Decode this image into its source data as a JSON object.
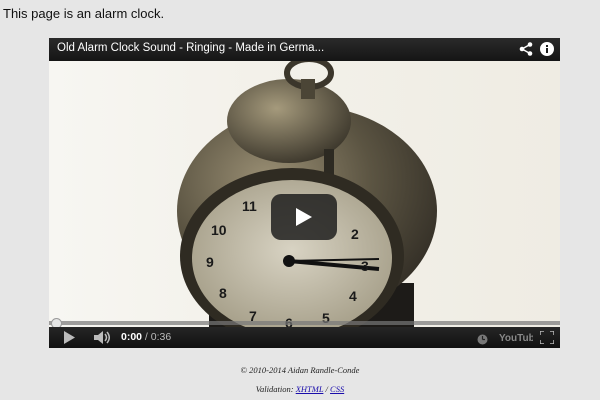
{
  "page": {
    "intro_text": "This page is an alarm clock."
  },
  "player": {
    "title": "Old Alarm Clock Sound - Ringing - Made in Germa...",
    "current_time": "0:00",
    "separator": " / ",
    "duration": "0:36",
    "progress_fraction": 0.0,
    "brand": "YouTube",
    "icons": {
      "share": "share-icon",
      "info": "info-icon",
      "play_overlay": "play-icon",
      "play": "play-icon",
      "volume": "volume-icon",
      "settings": "clock-icon",
      "fullscreen": "fullscreen-icon"
    },
    "clock_face_numbers": [
      "11",
      "10",
      "9",
      "8",
      "7",
      "6",
      "5",
      "4",
      "3",
      "2"
    ]
  },
  "footer": {
    "copyright": "© 2010-2014 Aidan Randle-Conde",
    "validation_label": "Validation: ",
    "xhtml_link": "XHTML",
    "slash": " / ",
    "css_link": "CSS"
  },
  "colors": {
    "page_bg": "#e6e6e6",
    "progress_accent": "#cc181e",
    "link": "#1a0dab"
  }
}
